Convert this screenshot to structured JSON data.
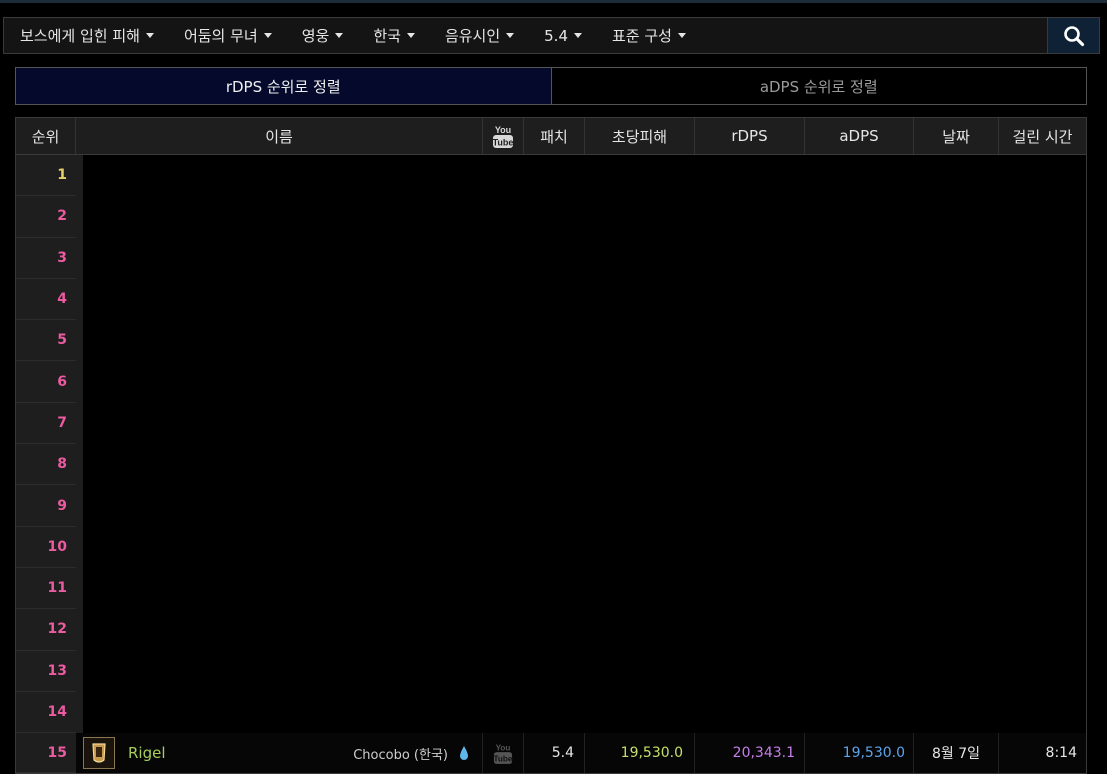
{
  "filters": [
    {
      "label": "보스에게 입힌 피해"
    },
    {
      "label": "어둠의 무녀"
    },
    {
      "label": "영웅"
    },
    {
      "label": "한국"
    },
    {
      "label": "음유시인"
    },
    {
      "label": "5.4"
    },
    {
      "label": "표준 구성"
    }
  ],
  "search": {
    "icon": "search-icon"
  },
  "sort_tabs": {
    "rdps": "rDPS 순위로 정렬",
    "adps": "aDPS 순위로 정렬"
  },
  "table": {
    "headers": {
      "rank": "순위",
      "name": "이름",
      "youtube_icon": "youtube-icon",
      "patch": "패치",
      "dps": "초당피해",
      "rdps": "rDPS",
      "adps": "aDPS",
      "date": "날짜",
      "duration": "걸린 시간"
    },
    "empty_ranks": [
      "1",
      "2",
      "3",
      "4",
      "5",
      "6",
      "7",
      "8",
      "9",
      "10",
      "11",
      "12",
      "13",
      "14"
    ],
    "last_row": {
      "rank": "15",
      "job_icon": "bard-job-icon",
      "name": "Rigel",
      "server": "Chocobo (한국)",
      "patch": "5.4",
      "dps": "19,530.0",
      "rdps": "20,343.1",
      "adps": "19,530.0",
      "date": "8월 7일",
      "duration": "8:14"
    }
  },
  "colors": {
    "rank_top": "#e7d06a",
    "rank": "#ec5aa0",
    "name": "#a6cf5c",
    "dps": "#c5e06a",
    "rdps": "#c67fe8",
    "adps": "#5ea3ea",
    "active_tab_bg": "#050a2c",
    "search_bg": "#0e2135"
  }
}
